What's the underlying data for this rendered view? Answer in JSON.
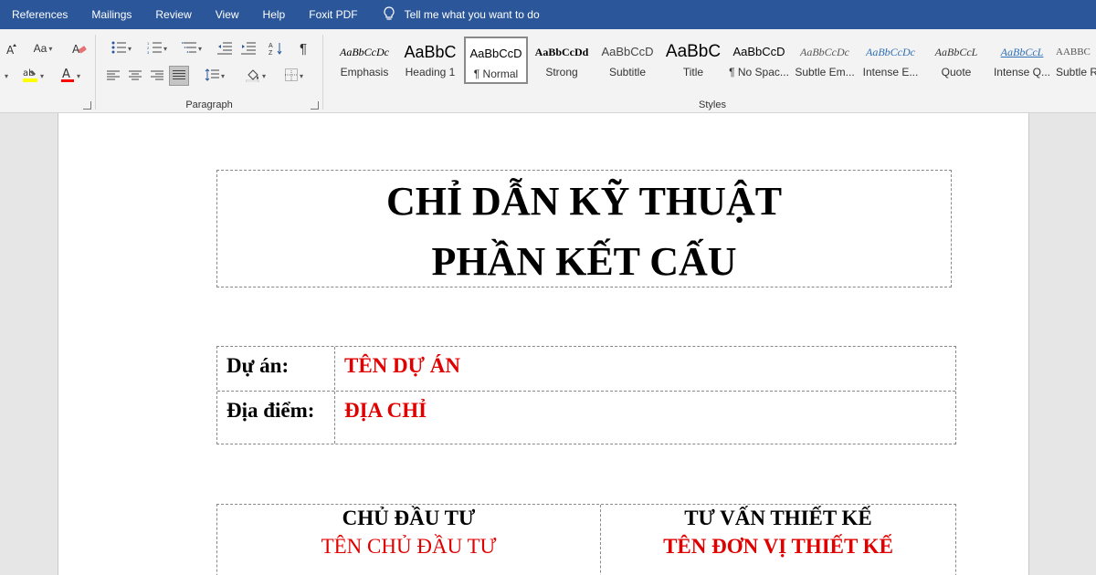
{
  "menu": {
    "items": [
      "References",
      "Mailings",
      "Review",
      "View",
      "Help",
      "Foxit PDF"
    ],
    "tell_me": "Tell me what you want to do"
  },
  "ribbon": {
    "font_group": {
      "change_case": "Aa"
    },
    "paragraph_group": {
      "label": "Paragraph",
      "show_marks": "¶"
    },
    "styles_group": {
      "label": "Styles",
      "tiles": [
        {
          "preview": "AaBbCcDc",
          "name": "Emphasis"
        },
        {
          "preview": "AaBbC",
          "name": "Heading 1"
        },
        {
          "preview": "AaBbCcD",
          "name": "¶ Normal"
        },
        {
          "preview": "AaBbCcDd",
          "name": "Strong"
        },
        {
          "preview": "AaBbCcD",
          "name": "Subtitle"
        },
        {
          "preview": "AaBbC",
          "name": "Title"
        },
        {
          "preview": "AaBbCcD",
          "name": "¶ No Spac..."
        },
        {
          "preview": "AaBbCcDc",
          "name": "Subtle Em..."
        },
        {
          "preview": "AaBbCcDc",
          "name": "Intense E..."
        },
        {
          "preview": "AaBbCcL",
          "name": "Quote"
        },
        {
          "preview": "AaBbCcL",
          "name": "Intense Q..."
        },
        {
          "preview": "AABBC",
          "name": "Subtle R"
        }
      ]
    }
  },
  "document": {
    "title_line1": "CHỈ DẪN KỸ THUẬT",
    "title_line2": "PHẦN KẾT CẤU",
    "project_label": "Dự án:",
    "project_value": "TÊN DỰ ÁN",
    "location_label": "Địa điểm:",
    "location_value": "ĐỊA CHỈ",
    "owner_heading": "CHỦ ĐẦU TƯ",
    "owner_value": "TÊN CHỦ ĐẦU TƯ",
    "consultant_heading": "TƯ VẤN THIẾT KẾ",
    "consultant_value": "TÊN ĐƠN VỊ THIẾT KẾ"
  },
  "colors": {
    "title_bar": "#2b579a",
    "placeholder_red": "#e00000",
    "highlight_yellow": "#ffff00",
    "font_color_red": "#ff0000"
  },
  "icons": [
    "lightbulb-icon",
    "grow-font-icon",
    "change-case-icon",
    "clear-formatting-icon",
    "text-highlight-icon",
    "font-color-icon",
    "bullets-icon",
    "numbering-icon",
    "multilevel-list-icon",
    "decrease-indent-icon",
    "increase-indent-icon",
    "sort-icon",
    "show-marks-icon",
    "align-left-icon",
    "align-center-icon",
    "align-right-icon",
    "justify-icon",
    "line-spacing-icon",
    "shading-icon",
    "borders-icon"
  ]
}
